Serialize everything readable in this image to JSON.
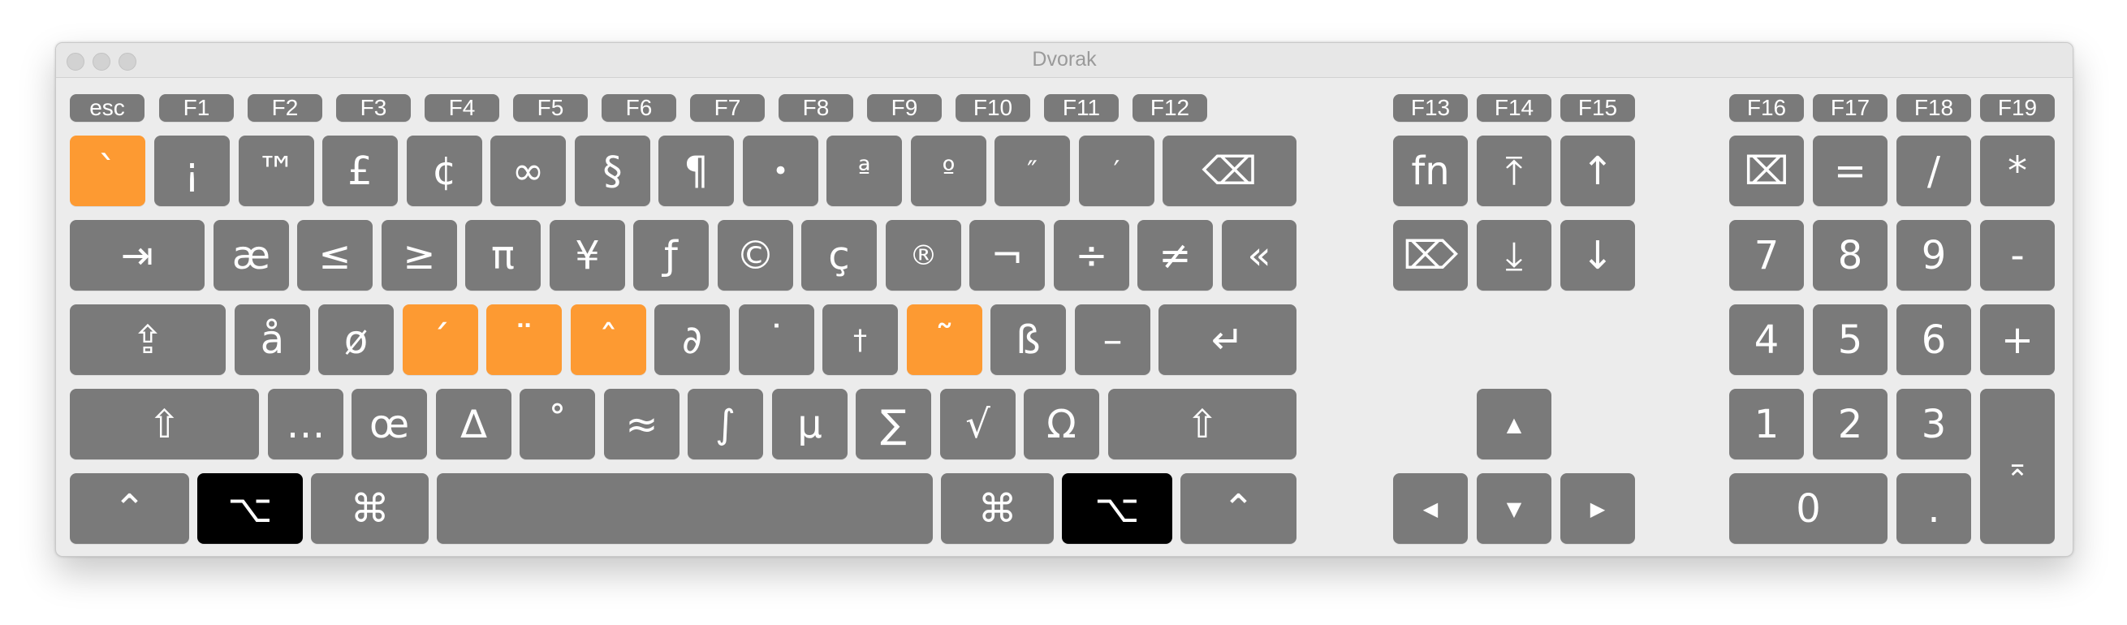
{
  "window": {
    "title": "Dvorak",
    "close_icon": "traffic-light-close",
    "minimize_icon": "traffic-light-minimize",
    "zoom_icon": "traffic-light-zoom"
  },
  "colors": {
    "key": "#7a7a7a",
    "dead_key": "#fd9a32",
    "active_modifier": "#000000",
    "background": "#ececec"
  },
  "function_row": {
    "esc": "esc",
    "f1": "F1",
    "f2": "F2",
    "f3": "F3",
    "f4": "F4",
    "f5": "F5",
    "f6": "F6",
    "f7": "F7",
    "f8": "F8",
    "f9": "F9",
    "f10": "F10",
    "f11": "F11",
    "f12": "F12",
    "f13": "F13",
    "f14": "F14",
    "f15": "F15",
    "f16": "F16",
    "f17": "F17",
    "f18": "F18",
    "f19": "F19"
  },
  "row1": {
    "k0": "`",
    "k1": "¡",
    "k2": "™",
    "k3": "£",
    "k4": "¢",
    "k5": "∞",
    "k6": "§",
    "k7": "¶",
    "k8": "•",
    "k9": "ª",
    "k10": "º",
    "k11": "″",
    "k12": "′",
    "delete": "⌫"
  },
  "row2": {
    "tab": "⇥",
    "k1": "æ",
    "k2": "≤",
    "k3": "≥",
    "k4": "π",
    "k5": "¥",
    "k6": "ƒ",
    "k7": "©",
    "k8": "ç",
    "k9": "®",
    "k10": "¬",
    "k11": "÷",
    "k12": "≠",
    "k13": "«"
  },
  "row3": {
    "caps": "⇪",
    "k1": "å",
    "k2": "ø",
    "k3": "´",
    "k4": "¨",
    "k5": "ˆ",
    "k6": "∂",
    "k7": "˙",
    "k8": "†",
    "k9": "˜",
    "k10": "ß",
    "k11": "–",
    "return": "↵"
  },
  "row4": {
    "lshift": "⇧",
    "k1": "…",
    "k2": "œ",
    "k3": "∆",
    "k4": "˚",
    "k5": "≈",
    "k6": "∫",
    "k7": "µ",
    "k8": "∑",
    "k9": "√",
    "k10": "Ω",
    "rshift": "⇧"
  },
  "row5": {
    "lctrl": "⌃",
    "lopt": "⌥",
    "lcmd": "⌘",
    "space": "",
    "rcmd": "⌘",
    "ropt": "⌥",
    "rctrl": "⌃"
  },
  "nav": {
    "fn": "fn",
    "home": "⤒",
    "pageup": "↑",
    "fwddelete": "⌦",
    "end": "⤓",
    "pagedown": "↓",
    "up": "▲",
    "left": "◀",
    "down": "▼",
    "right": "▶"
  },
  "numpad": {
    "clear": "⌧",
    "equals": "=",
    "divide": "/",
    "multiply": "*",
    "n7": "7",
    "n8": "8",
    "n9": "9",
    "minus": "-",
    "n4": "4",
    "n5": "5",
    "n6": "6",
    "plus": "+",
    "n1": "1",
    "n2": "2",
    "n3": "3",
    "enter": "⌅",
    "n0": "0",
    "decimal": "."
  }
}
